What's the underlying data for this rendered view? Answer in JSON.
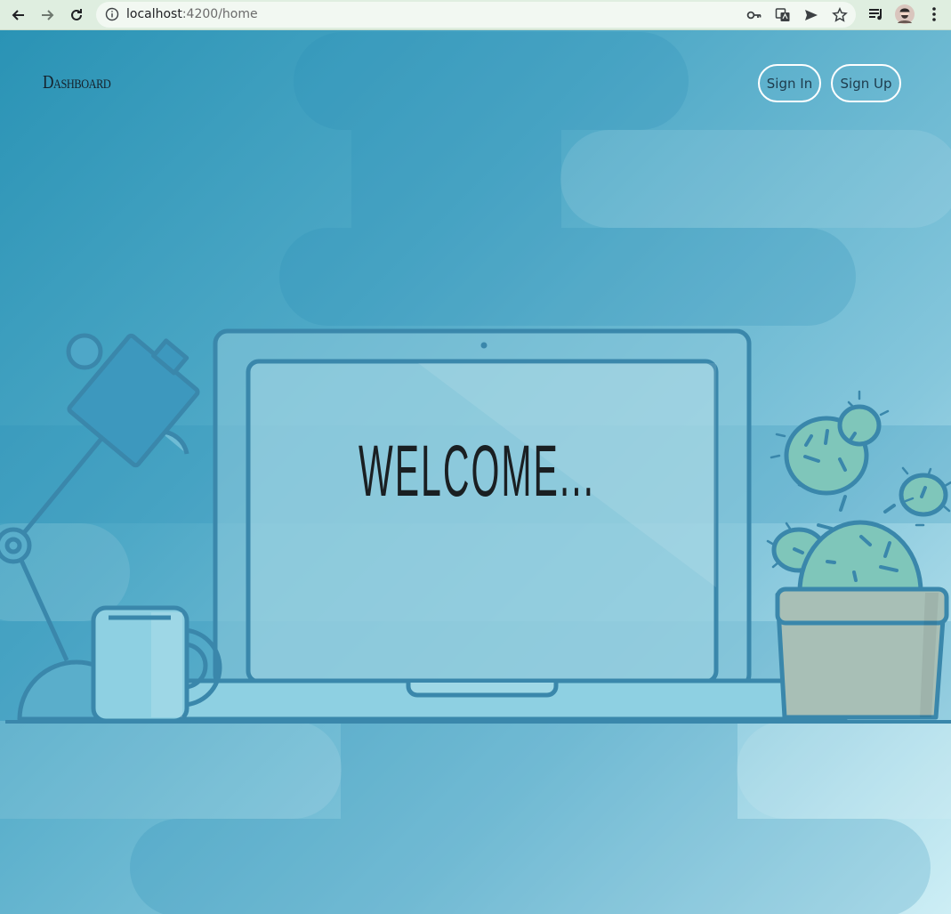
{
  "browser": {
    "url_host": "localhost",
    "url_path": ":4200/home",
    "icons": [
      "back-arrow-icon",
      "forward-arrow-icon",
      "reload-icon",
      "info-icon",
      "key-icon",
      "translate-icon",
      "send-icon",
      "star-icon",
      "media-icon",
      "profile-avatar",
      "menu-icon"
    ]
  },
  "page": {
    "brand": "Dashboard",
    "nav": {
      "sign_in": "Sign In",
      "sign_up": "Sign Up"
    },
    "hero_text": "WELCOME...",
    "colors": {
      "bg_dark": "#2a93b5",
      "bg_light": "#cdeef5",
      "outline": "#3a87ab",
      "cactus": "#7fc6ba",
      "pot": "#a8bfb6"
    }
  }
}
